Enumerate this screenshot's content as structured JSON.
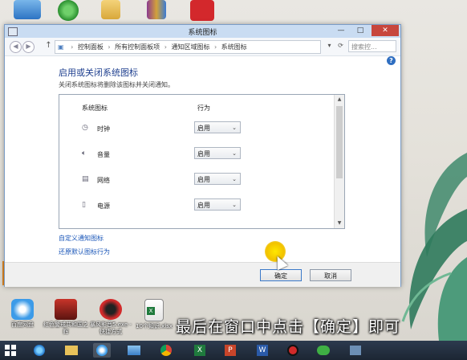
{
  "window": {
    "title": "系统图标",
    "controls": {
      "minimize": "—",
      "maximize": "□",
      "close": "✕"
    }
  },
  "address_bar": {
    "crumbs": [
      "控制面板",
      "所有控制面板项",
      "通知区域图标",
      "系统图标"
    ],
    "search_placeholder": "搜索控..."
  },
  "page": {
    "heading": "启用或关闭系统图标",
    "description": "关闭系统图标将删除该图标并关闭通知。"
  },
  "icon_list": {
    "columns": {
      "icon": "系统图标",
      "behavior": "行为"
    },
    "rows": [
      {
        "name": "时钟",
        "icon": "clock-icon",
        "value": "启用"
      },
      {
        "name": "音量",
        "icon": "volume-icon",
        "value": "启用"
      },
      {
        "name": "网络",
        "icon": "network-icon",
        "value": "启用"
      },
      {
        "name": "电源",
        "icon": "power-icon",
        "value": "启用"
      }
    ]
  },
  "links": {
    "customize": "自定义通知图标",
    "restore": "还原默认图标行为"
  },
  "buttons": {
    "ok": "确定",
    "cancel": "取消"
  },
  "desktop_icons": [
    {
      "label": "百度网盘",
      "icon": "baidu-cloud-icon"
    },
    {
      "label": "红色警戒共和国之辉",
      "icon": "red-alert-icon"
    },
    {
      "label": "暴风影音5.exe - 快捷方式",
      "icon": "storm-player-icon"
    },
    {
      "label": "10个知识.xlsx",
      "icon": "excel-file-icon"
    }
  ],
  "caption": "最后在窗口中点击【确定】即可",
  "colors": {
    "heading_blue": "#1e3f8f",
    "link_blue": "#1a56b8",
    "close_red": "#c7463d",
    "taskbar": "#1c2633",
    "highlight_yellow": "#f2c200"
  }
}
